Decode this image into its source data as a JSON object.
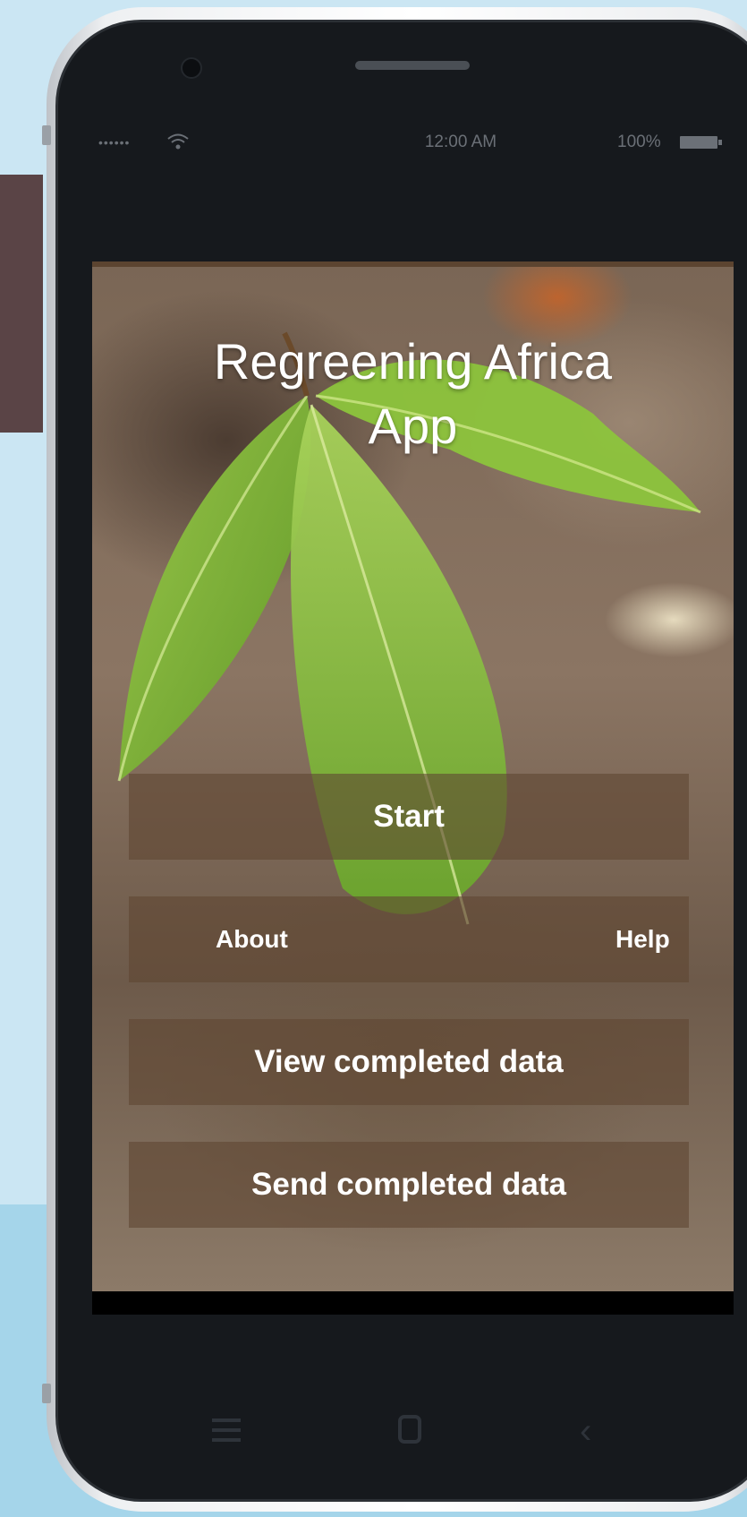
{
  "status_bar": {
    "signal": "••••••",
    "time": "12:00 AM",
    "battery": "100%"
  },
  "app": {
    "title_line1": "Regreening Africa",
    "title_line2": "App"
  },
  "menu": {
    "start": "Start",
    "about": "About",
    "help": "Help",
    "view_completed": "View completed data",
    "send_completed": "Send completed data"
  },
  "nav_bar": {
    "back_glyph": "‹"
  },
  "colors": {
    "button_overlay": "#5f4632",
    "phone_screen_bezel": "#16191d",
    "leaf_green": "#7fbf3a"
  }
}
